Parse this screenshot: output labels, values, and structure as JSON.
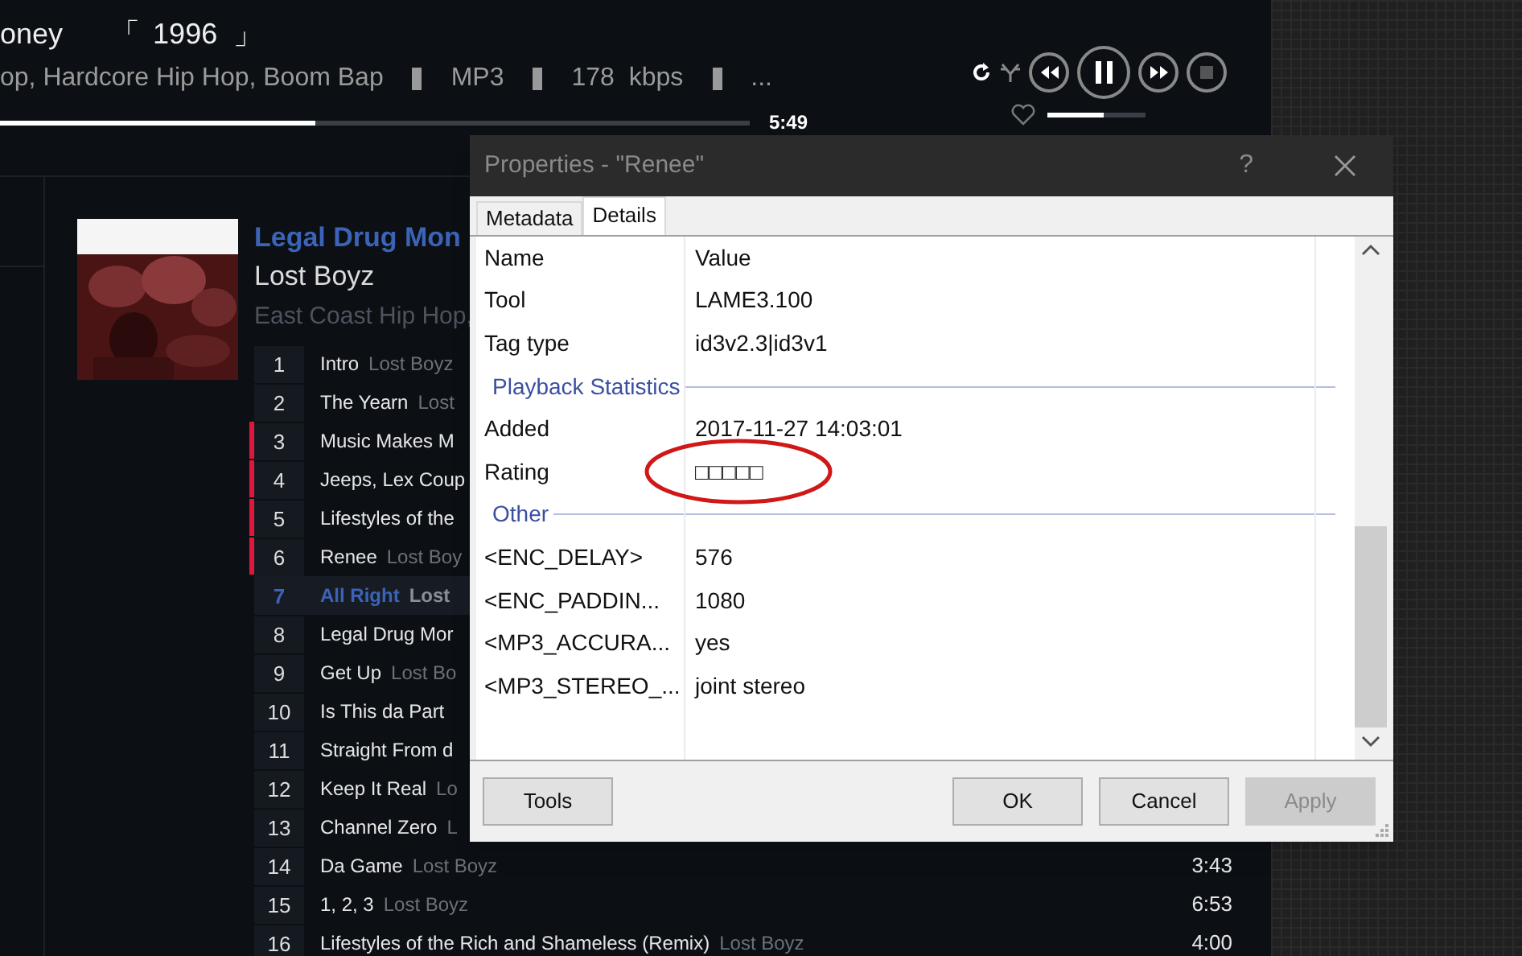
{
  "now_playing": {
    "title": "oney",
    "year_open": "「",
    "year": "1996",
    "year_close": "」",
    "tags": [
      "op, Hardcore Hip Hop, Boom Bap",
      "MP3",
      "178  kbps",
      "..."
    ],
    "progress": {
      "level": 0.42
    },
    "time": "5:49",
    "playing": true,
    "favorite": false,
    "volume": {
      "level": 0.57
    }
  },
  "album": {
    "title": "Legal Drug Mon",
    "artist": "Lost Boyz",
    "genre": "East Coast Hip Hop,"
  },
  "tracks": [
    {
      "number": "1",
      "title": "Intro",
      "artist": "Lost Boyz",
      "marked": false,
      "playing": false
    },
    {
      "number": "2",
      "title": "The Yearn",
      "artist": "Lost",
      "marked": false,
      "playing": false
    },
    {
      "number": "3",
      "title": "Music Makes M",
      "marked": true,
      "playing": false
    },
    {
      "number": "4",
      "title": "Jeeps, Lex Coup",
      "marked": true,
      "playing": false
    },
    {
      "number": "5",
      "title": "Lifestyles of the",
      "marked": true,
      "playing": false
    },
    {
      "number": "6",
      "title": "Renee",
      "artist": "Lost Boy",
      "marked": true,
      "playing": false
    },
    {
      "number": "7",
      "title": "All Right",
      "artist": "Lost",
      "marked": false,
      "playing": true
    },
    {
      "number": "8",
      "title": "Legal Drug Mor",
      "marked": false,
      "playing": false
    },
    {
      "number": "9",
      "title": "Get Up",
      "artist": "Lost Bo",
      "marked": false,
      "playing": false
    },
    {
      "number": "10",
      "title": "Is This da Part",
      "marked": false,
      "playing": false
    },
    {
      "number": "11",
      "title": "Straight From d",
      "marked": false,
      "playing": false
    },
    {
      "number": "12",
      "title": "Keep It Real",
      "artist": "Lo",
      "marked": false,
      "playing": false
    },
    {
      "number": "13",
      "title": "Channel Zero",
      "artist": "L",
      "marked": false,
      "playing": false
    },
    {
      "number": "14",
      "title": "Da Game",
      "artist": "Lost Boyz",
      "duration": "3:43",
      "marked": false,
      "playing": false
    },
    {
      "number": "15",
      "title": "1, 2, 3",
      "artist": "Lost Boyz",
      "duration": "6:53",
      "marked": false,
      "playing": false
    },
    {
      "number": "16",
      "title": "Lifestyles of the Rich and Shameless (Remix)",
      "artist": "Lost Boyz",
      "duration": "4:00",
      "marked": false,
      "playing": false
    }
  ],
  "dialog": {
    "title": "Properties - \"Renee\"",
    "help": "?",
    "tabs": [
      {
        "label": "Metadata",
        "selected": false
      },
      {
        "label": "Details",
        "selected": true
      }
    ],
    "columns": [
      "Name",
      "Value"
    ],
    "rows": [
      {
        "kind": "field",
        "name": "Tool",
        "value": "LAME3.100"
      },
      {
        "kind": "field",
        "name": "Tag type",
        "value": "id3v2.3|id3v1"
      },
      {
        "kind": "group",
        "label": "Playback Statistics"
      },
      {
        "kind": "field",
        "name": "Added",
        "value": "2017-11-27 14:03:01"
      },
      {
        "kind": "field",
        "name": "Rating",
        "value": "□□□□□",
        "circled": true
      },
      {
        "kind": "group",
        "label": "Other"
      },
      {
        "kind": "field",
        "name": "<ENC_DELAY>",
        "value": "576"
      },
      {
        "kind": "field",
        "name": "<ENC_PADDIN...",
        "value": "1080"
      },
      {
        "kind": "field",
        "name": "<MP3_ACCURA...",
        "value": "yes"
      },
      {
        "kind": "field",
        "name": "<MP3_STEREO_...",
        "value": "joint stereo"
      }
    ],
    "buttons": [
      {
        "label": "Tools",
        "disabled": false,
        "kind": "left"
      },
      {
        "label": "OK",
        "disabled": false,
        "kind": "right"
      },
      {
        "label": "Cancel",
        "disabled": false,
        "kind": "right"
      },
      {
        "label": "Apply",
        "disabled": true,
        "kind": "right"
      }
    ]
  }
}
